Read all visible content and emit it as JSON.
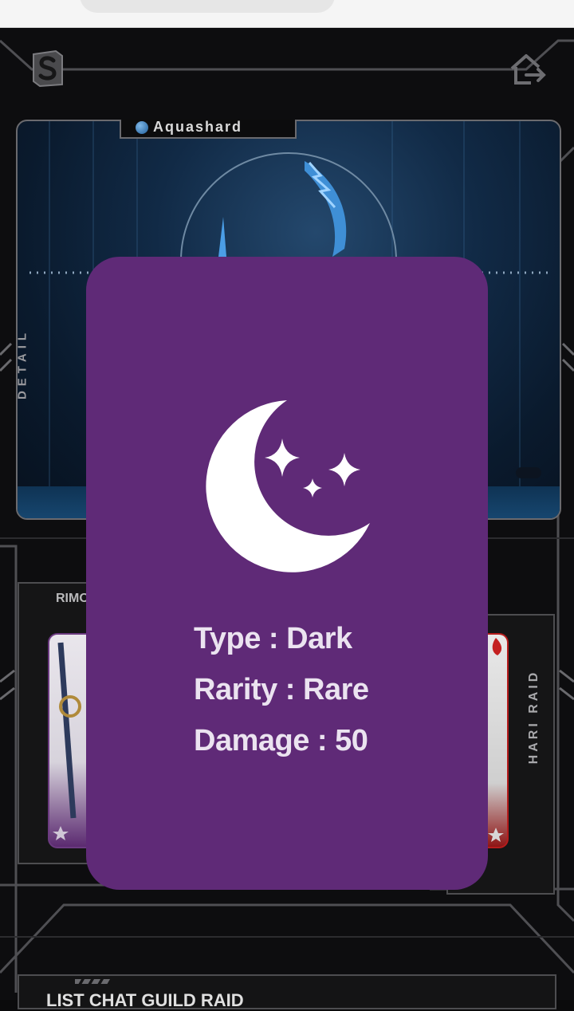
{
  "character": {
    "name": "Aquashard",
    "element_color": "#2f7fc4"
  },
  "side_labels": {
    "left": "DETAIL",
    "right": "HARI RAID"
  },
  "cards": {
    "left_name": "RIMO"
  },
  "bottom_section": {
    "title": "LIST CHAT GUILD RAID"
  },
  "popup": {
    "icon": "moon-stars-icon",
    "background": "#5f2a77",
    "stats": [
      {
        "label": "Type",
        "separator": " : ",
        "value": "Dark"
      },
      {
        "label": "Rarity",
        "separator": " : ",
        "value": "Rare"
      },
      {
        "label": "Damage",
        "separator": " : ",
        "value": "50"
      }
    ]
  },
  "icons": {
    "logo": "logo-icon",
    "home_exit": "home-exit-icon"
  }
}
